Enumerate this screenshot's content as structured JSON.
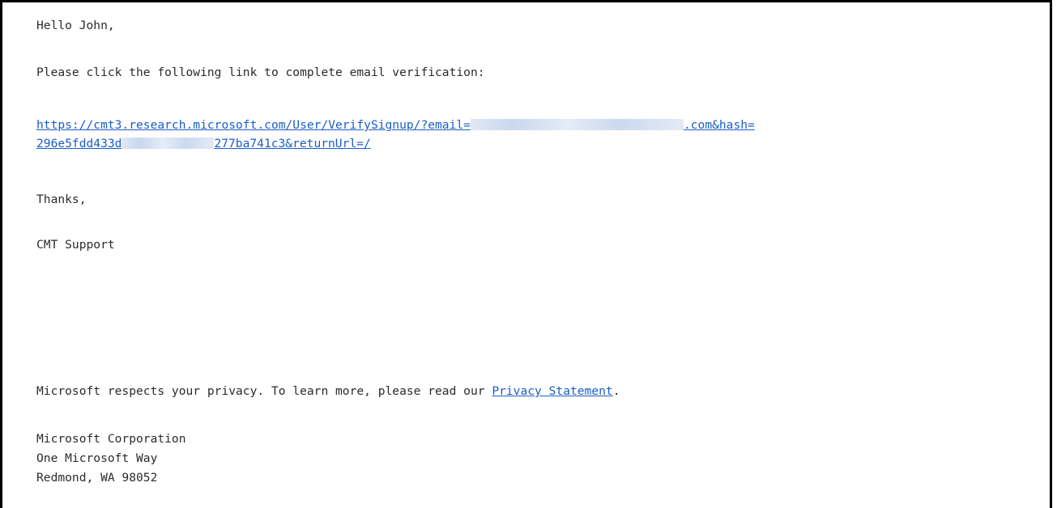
{
  "email": {
    "greeting": "Hello John,",
    "instruction": "Please click the following link to complete email verification:",
    "link": {
      "part1_prefix": "https://cmt3.research.microsoft.com/User/VerifySignup/?email=",
      "part1_suffix": ".com&hash=",
      "part2_prefix": "296e5fdd433d",
      "part2_suffix": "277ba741c3&returnUrl=/"
    },
    "thanks": "Thanks,",
    "signature": "CMT Support",
    "privacy_prefix": "Microsoft respects your privacy. To learn more, please read our ",
    "privacy_link": "Privacy Statement",
    "privacy_suffix": ".",
    "address": {
      "company": "Microsoft Corporation",
      "street": "One Microsoft Way",
      "city": "Redmond, WA 98052"
    }
  },
  "colors": {
    "link": "#1a5dc8",
    "text": "#2b2b2b",
    "border": "#000000"
  }
}
